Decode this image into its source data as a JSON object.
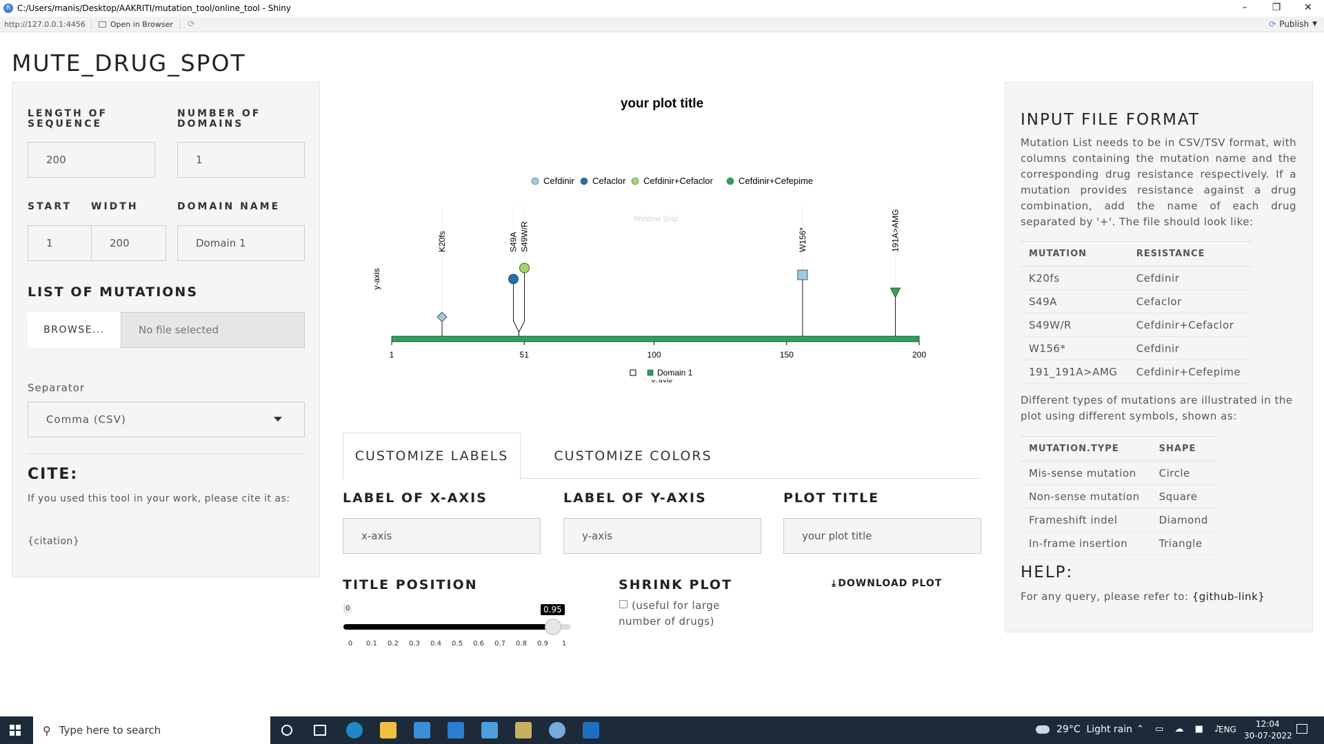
{
  "window": {
    "title": "C:/Users/manis/Desktop/AAKRITI/mutation_tool/online_tool - Shiny",
    "url": "http://127.0.0.1:4456",
    "open_browser": "Open in Browser",
    "publish": "Publish"
  },
  "app": {
    "title": "MUTE_DRUG_SPOT"
  },
  "sidebar": {
    "length_label": "LENGTH OF SEQUENCE",
    "length_value": "200",
    "domains_label": "NUMBER OF DOMAINS",
    "domains_value": "1",
    "start_label": "START",
    "start_value": "1",
    "width_label": "WIDTH",
    "width_value": "200",
    "domain_name_label": "DOMAIN NAME",
    "domain_name_value": "Domain 1",
    "mutations_heading": "LIST OF MUTATIONS",
    "browse_label": "BROWSE...",
    "file_status": "No file selected",
    "separator_label": "Separator",
    "separator_value": "Comma (CSV)",
    "cite_heading": "CITE:",
    "cite_text": "If you used this tool in your work, please cite it as:",
    "citation": "{citation}"
  },
  "chart_data": {
    "type": "scatter",
    "title": "your plot title",
    "xlabel": "x-axis",
    "ylabel": "y-axis",
    "xlim": [
      1,
      200
    ],
    "x_ticks": [
      1,
      51,
      100,
      150,
      200
    ],
    "legend_top": [
      {
        "name": "Cefdinir",
        "color": "#9ecae1"
      },
      {
        "name": "Cefaclor",
        "color": "#2171b5"
      },
      {
        "name": "Cefdinir+Cefaclor",
        "color": "#a1d76a"
      },
      {
        "name": "Cefdinir+Cefepime",
        "color": "#31a354"
      }
    ],
    "legend_bottom": [
      {
        "name": "",
        "color": "#ffffff"
      },
      {
        "name": "Domain 1",
        "color": "#2ca25f"
      }
    ],
    "domain": {
      "name": "Domain 1",
      "start": 1,
      "end": 200,
      "color": "#2ca25f"
    },
    "mutations": [
      {
        "label": "K20fs",
        "x": 20,
        "shape": "diamond",
        "color": "#9ecae1",
        "drug": "Cefdinir"
      },
      {
        "label": "S49A",
        "x": 49,
        "shape": "circle",
        "color": "#2171b5",
        "drug": "Cefaclor"
      },
      {
        "label": "S49W/R",
        "x": 49,
        "shape": "circle",
        "color": "#a1d76a",
        "drug": "Cefdinir+Cefaclor"
      },
      {
        "label": "W156*",
        "x": 156,
        "shape": "square",
        "color": "#9ecae1",
        "drug": "Cefdinir"
      },
      {
        "label": "191A>AMG",
        "x": 191,
        "shape": "triangle",
        "color": "#31a354",
        "drug": "Cefdinir+Cefepime"
      }
    ],
    "watermark": "Window Snip"
  },
  "tabs": {
    "labels": "CUSTOMIZE LABELS",
    "colors": "CUSTOMIZE COLORS"
  },
  "controls": {
    "xaxis_label": "LABEL OF X-AXIS",
    "xaxis_value": "x-axis",
    "yaxis_label": "LABEL OF Y-AXIS",
    "yaxis_value": "y-axis",
    "plot_title_label": "PLOT TITLE",
    "plot_title_value": "your plot title",
    "title_position_label": "TITLE POSITION",
    "slider_min": "0",
    "slider_value": "0.95",
    "slider_fraction": 0.95,
    "slider_ticks": [
      "0",
      "0.1",
      "0.2",
      "0.3",
      "0.4",
      "0.5",
      "0.6",
      "0.7",
      "0.8",
      "0.9",
      "1"
    ],
    "shrink_label": "SHRINK PLOT",
    "shrink_text": "(useful for large number of drugs)",
    "download_label": "DOWNLOAD PLOT"
  },
  "info": {
    "heading": "INPUT FILE FORMAT",
    "description": "Mutation List needs to be in CSV/TSV format, with columns containing the mutation name and the corresponding drug resistance respectively. If a mutation provides resistance against a drug combination, add the name of each drug separated by '+'. The file should look like:",
    "table1_headers": [
      "MUTATION",
      "RESISTANCE"
    ],
    "table1_rows": [
      [
        "K20fs",
        "Cefdinir"
      ],
      [
        "S49A",
        "Cefaclor"
      ],
      [
        "S49W/R",
        "Cefdinir+Cefaclor"
      ],
      [
        "W156*",
        "Cefdinir"
      ],
      [
        "191_191A>AMG",
        "Cefdinir+Cefepime"
      ]
    ],
    "types_text": "Different types of mutations are illustrated in the plot using different symbols, shown as:",
    "table2_headers": [
      "MUTATION.TYPE",
      "SHAPE"
    ],
    "table2_rows": [
      [
        "Mis-sense mutation",
        "Circle"
      ],
      [
        "Non-sense mutation",
        "Square"
      ],
      [
        "Frameshift indel",
        "Diamond"
      ],
      [
        "In-frame insertion",
        "Triangle"
      ]
    ],
    "help_heading": "HELP:",
    "help_text": "For any query, please refer to:",
    "help_link": "{github-link}"
  },
  "taskbar": {
    "search_placeholder": "Type here to search",
    "weather": "29°C  Light rain",
    "lang": "ENG",
    "time": "12:04",
    "date": "30-07-2022"
  }
}
